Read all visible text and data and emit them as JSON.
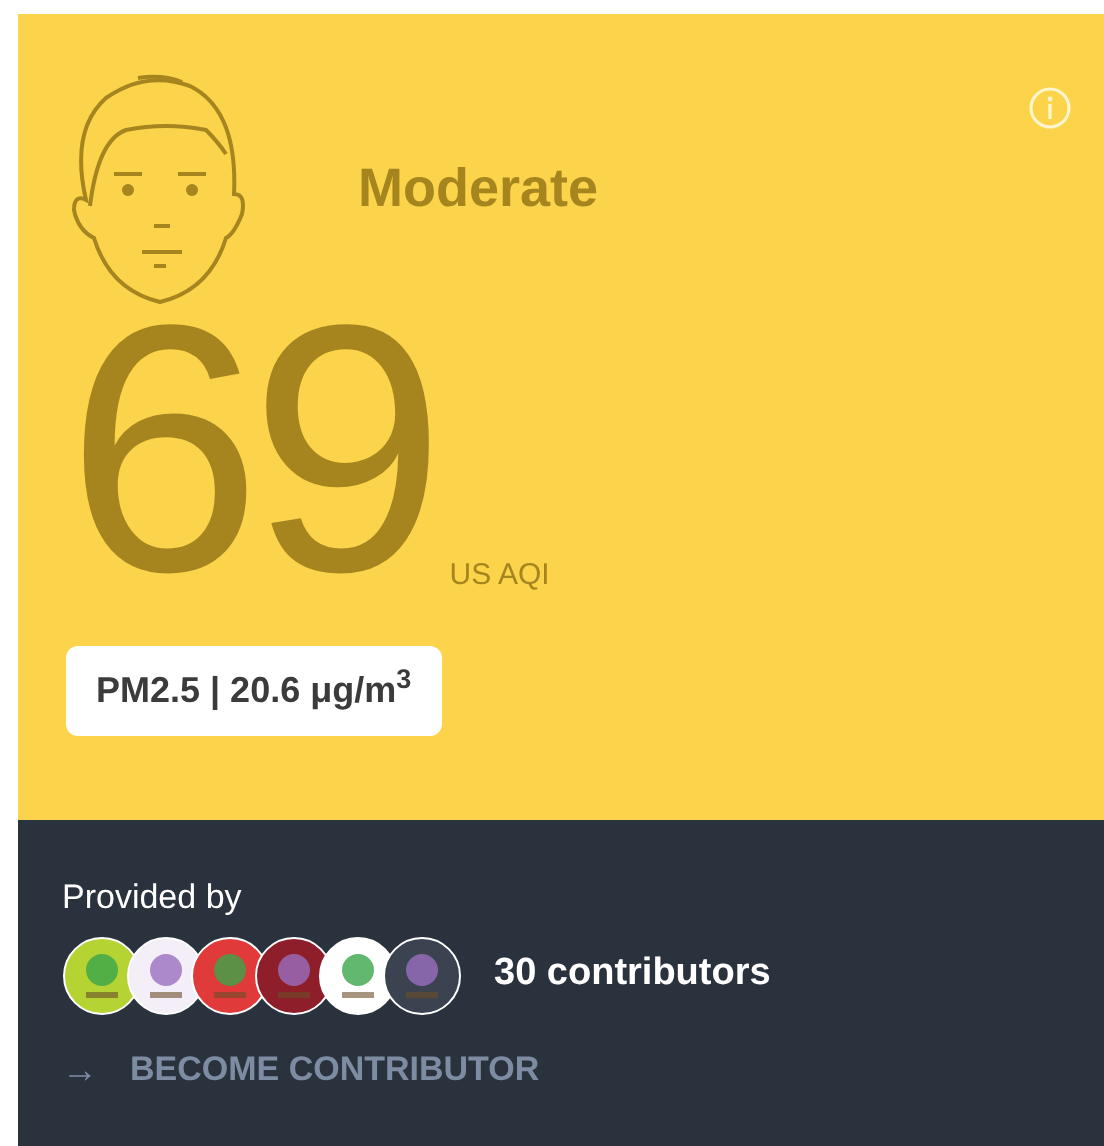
{
  "status": {
    "label": "Moderate",
    "color": "#a6851f"
  },
  "aqi": {
    "value": "69",
    "unit": "US AQI"
  },
  "pollutant": "PM2.5 | 20.6 μg/m$^{3}$",
  "provided_by": "Provided by",
  "contributor_logos": [
    {
      "color": "#b5d333"
    },
    {
      "color": "#f4eef8"
    },
    {
      "color": "#e03a3a"
    },
    {
      "color": "#8e1f2a"
    },
    {
      "color": "#ffffff"
    },
    {
      "color": "#3a434f"
    }
  ],
  "contributors": "30 contributors",
  "become": {
    "arrow": "→",
    "label": "BECOME CONTRIBUTOR"
  }
}
